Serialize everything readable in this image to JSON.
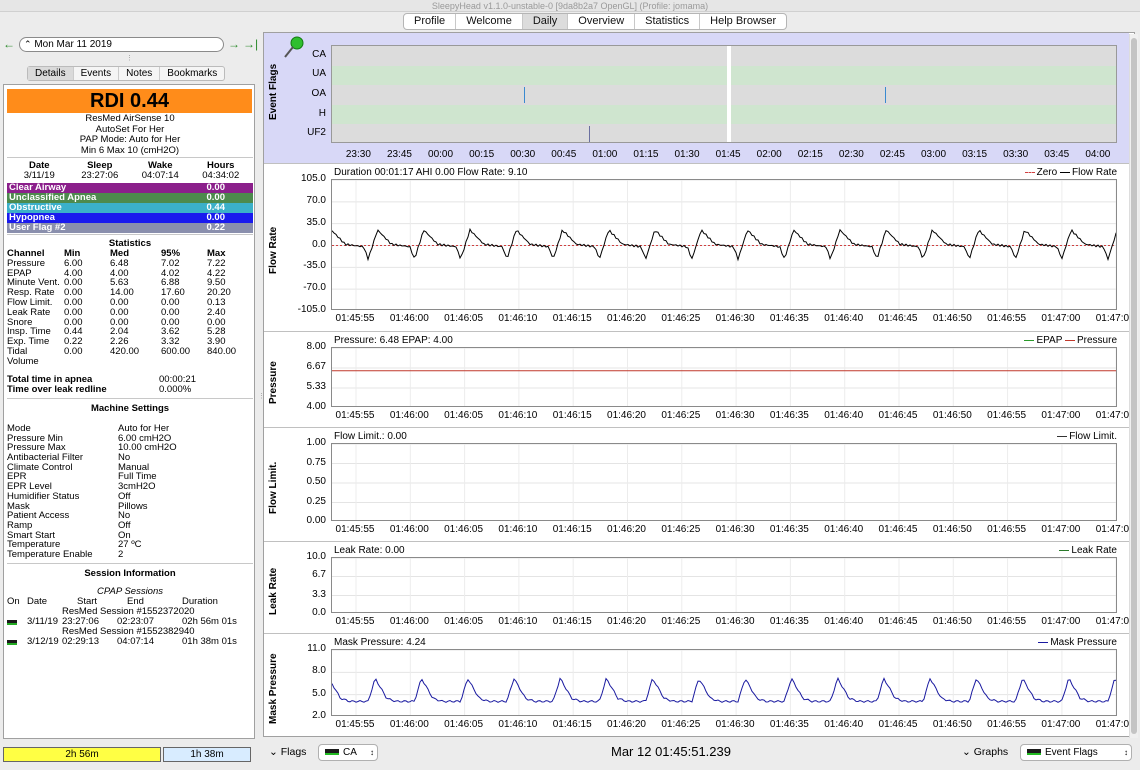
{
  "window": {
    "title": "SleepyHead v1.1.0-unstable-0 [9da8b2a7 OpenGL] (Profile: jomama)"
  },
  "tabs": [
    {
      "label": "Profile",
      "selected": false
    },
    {
      "label": "Welcome",
      "selected": false
    },
    {
      "label": "Daily",
      "selected": true
    },
    {
      "label": "Overview",
      "selected": false
    },
    {
      "label": "Statistics",
      "selected": false
    },
    {
      "label": "Help Browser",
      "selected": false
    }
  ],
  "left": {
    "nav": {
      "prev_icon": "arrow-left-icon",
      "date": "Mon Mar 11 2019",
      "next_icon": "arrow-right-icon",
      "last_icon": "jump-last-icon"
    },
    "tabs": [
      "Details",
      "Events",
      "Notes",
      "Bookmarks"
    ],
    "rdi": {
      "label": "RDI 0.44",
      "color": "#ff8c1a"
    },
    "device": [
      "ResMed AirSense 10",
      "AutoSet For Her",
      "PAP Mode: Auto for Her",
      "Min 6 Max 10 (cmH2O)"
    ],
    "summary": {
      "headers": [
        "Date",
        "Sleep",
        "Wake",
        "Hours"
      ],
      "values": [
        "3/11/19",
        "23:27:06",
        "04:07:14",
        "04:34:02"
      ]
    },
    "events": [
      {
        "name": "Clear Airway",
        "value": "0.00",
        "color": "#8b1f8b"
      },
      {
        "name": "Unclassified Apnea",
        "value": "0.00",
        "color": "#4d8a4d"
      },
      {
        "name": "Obstructive",
        "value": "0.44",
        "color": "#3bb0c9"
      },
      {
        "name": "Hypopnea",
        "value": "0.00",
        "color": "#1a1aee"
      },
      {
        "name": "User Flag #2",
        "value": "0.22",
        "color": "#8a8fad"
      }
    ],
    "statistics": {
      "title": "Statistics",
      "headers": [
        "Channel",
        "Min",
        "Med",
        "95%",
        "Max"
      ],
      "rows": [
        [
          "Pressure",
          "6.00",
          "6.48",
          "7.02",
          "7.22"
        ],
        [
          "EPAP",
          "4.00",
          "4.00",
          "4.02",
          "4.22"
        ],
        [
          "Minute Vent.",
          "0.00",
          "5.63",
          "6.88",
          "9.50"
        ],
        [
          "Resp. Rate",
          "0.00",
          "14.00",
          "17.60",
          "20.20"
        ],
        [
          "Flow Limit.",
          "0.00",
          "0.00",
          "0.00",
          "0.13"
        ],
        [
          "Leak Rate",
          "0.00",
          "0.00",
          "0.00",
          "2.40"
        ],
        [
          "Snore",
          "0.00",
          "0.00",
          "0.00",
          "0.00"
        ],
        [
          "Insp. Time",
          "0.44",
          "2.04",
          "3.62",
          "5.28"
        ],
        [
          "Exp. Time",
          "0.22",
          "2.26",
          "3.32",
          "3.90"
        ],
        [
          "Tidal",
          "0.00",
          "420.00",
          "600.00",
          "840.00"
        ],
        [
          "Volume",
          "",
          "",
          "",
          ""
        ]
      ]
    },
    "totals": [
      {
        "label": "Total time in apnea",
        "value": "00:00:21"
      },
      {
        "label": "Time over leak redline",
        "value": "0.000%"
      }
    ],
    "machine": {
      "title": "Machine Settings",
      "rows": [
        [
          "Mode",
          "Auto for Her"
        ],
        [
          "Pressure Min",
          "6.00 cmH2O"
        ],
        [
          "Pressure Max",
          "10.00 cmH2O"
        ],
        [
          "Antibacterial Filter",
          "No"
        ],
        [
          "Climate Control",
          "Manual"
        ],
        [
          "EPR",
          "Full Time"
        ],
        [
          "EPR Level",
          "3cmH2O"
        ],
        [
          "Humidifier Status",
          "Off"
        ],
        [
          "Mask",
          "Pillows"
        ],
        [
          "Patient Access",
          "No"
        ],
        [
          "Ramp",
          "Off"
        ],
        [
          "Smart Start",
          "On"
        ],
        [
          "Temperature",
          "27 ºC"
        ],
        [
          "Temperature Enable",
          "2"
        ]
      ]
    },
    "sessions": {
      "title": "Session Information",
      "subtitle": "CPAP Sessions",
      "headers": [
        "On",
        "Date",
        "Start",
        "End",
        "Duration"
      ],
      "items": [
        {
          "name": "ResMed Session #1552372020",
          "date": "3/11/19",
          "start": "23:27:06",
          "end": "02:23:07",
          "duration": "02h 56m 01s"
        },
        {
          "name": "ResMed Session #1552382940",
          "date": "3/12/19",
          "start": "02:29:13",
          "end": "04:07:14",
          "duration": "01h 38m 01s"
        }
      ]
    },
    "duration_bars": [
      {
        "label": "2h 56m",
        "color": "#ffff44",
        "fraction": 0.64
      },
      {
        "label": "1h 38m",
        "color": "#d8ecff",
        "fraction": 0.36
      }
    ]
  },
  "flags_graph": {
    "title": "Event Flags",
    "pin_icon": "pushpin-icon",
    "rows": [
      "CA",
      "UA",
      "OA",
      "H",
      "UF2"
    ],
    "x_ticks": [
      "23:30",
      "23:45",
      "00:00",
      "00:15",
      "00:30",
      "00:45",
      "01:00",
      "01:15",
      "01:30",
      "01:45",
      "02:00",
      "02:15",
      "02:30",
      "02:45",
      "03:00",
      "03:15",
      "03:30",
      "03:45",
      "04:00"
    ],
    "x_range": [
      "23:20",
      "04:07"
    ],
    "marker": "01:45",
    "events": [
      {
        "row": "OA",
        "time": "00:30"
      },
      {
        "row": "OA",
        "time": "02:42"
      },
      {
        "row": "UF2",
        "time": "00:54"
      }
    ]
  },
  "x_ticks_detail": [
    "01:45:55",
    "01:46:00",
    "01:46:05",
    "01:46:10",
    "01:46:15",
    "01:46:20",
    "01:46:25",
    "01:46:30",
    "01:46:35",
    "01:46:40",
    "01:46:45",
    "01:46:50",
    "01:46:55",
    "01:47:00",
    "01:47:05"
  ],
  "chart_data": [
    {
      "type": "line",
      "title": "Flow Rate",
      "info": "Duration 00:01:17 AHI 0.00 Flow Rate: 9.10",
      "legend": [
        {
          "name": "Zero",
          "color": "#d04040",
          "dash": true
        },
        {
          "name": "Flow Rate",
          "color": "#000000"
        }
      ],
      "yticks": [
        "105.0",
        "70.0",
        "35.0",
        "0.0",
        "-35.0",
        "-70.0",
        "-105.0"
      ],
      "ylim": [
        -105,
        105
      ],
      "breath_count": 17,
      "peak": 25,
      "trough": -22
    },
    {
      "type": "line",
      "title": "Pressure",
      "info": "Pressure: 6.48 EPAP: 4.00",
      "legend": [
        {
          "name": "EPAP",
          "color": "#2a9a2a"
        },
        {
          "name": "Pressure",
          "color": "#c0392b"
        }
      ],
      "yticks": [
        "8.00",
        "6.67",
        "5.33",
        "4.00"
      ],
      "ylim": [
        4,
        8
      ],
      "series": [
        {
          "name": "Pressure",
          "value": 6.48
        },
        {
          "name": "EPAP",
          "value": 4.0
        }
      ]
    },
    {
      "type": "line",
      "title": "Flow Limit.",
      "info": "Flow Limit.: 0.00",
      "legend": [
        {
          "name": "Flow Limit.",
          "color": "#333333"
        }
      ],
      "yticks": [
        "1.00",
        "0.75",
        "0.50",
        "0.25",
        "0.00"
      ],
      "ylim": [
        0,
        1
      ]
    },
    {
      "type": "line",
      "title": "Leak Rate",
      "info": "Leak Rate: 0.00",
      "legend": [
        {
          "name": "Leak Rate",
          "color": "#2a7a2a"
        }
      ],
      "yticks": [
        "10.0",
        "6.7",
        "3.3",
        "0.0"
      ],
      "ylim": [
        0,
        10
      ]
    },
    {
      "type": "line",
      "title": "Mask Pressure",
      "info": "Mask Pressure: 4.24",
      "legend": [
        {
          "name": "Mask Pressure",
          "color": "#1a1aa0"
        }
      ],
      "yticks": [
        "11.0",
        "8.0",
        "5.0",
        "2.0"
      ],
      "ylim": [
        2,
        11
      ],
      "breath_count": 17,
      "base": 4.1,
      "peak": 7.2
    }
  ],
  "bottom": {
    "flags_label": "Flags",
    "flags_combo": "CA",
    "current_time": "Mar 12 01:45:51.239",
    "graphs_label": "Graphs",
    "graphs_combo": "Event Flags"
  }
}
